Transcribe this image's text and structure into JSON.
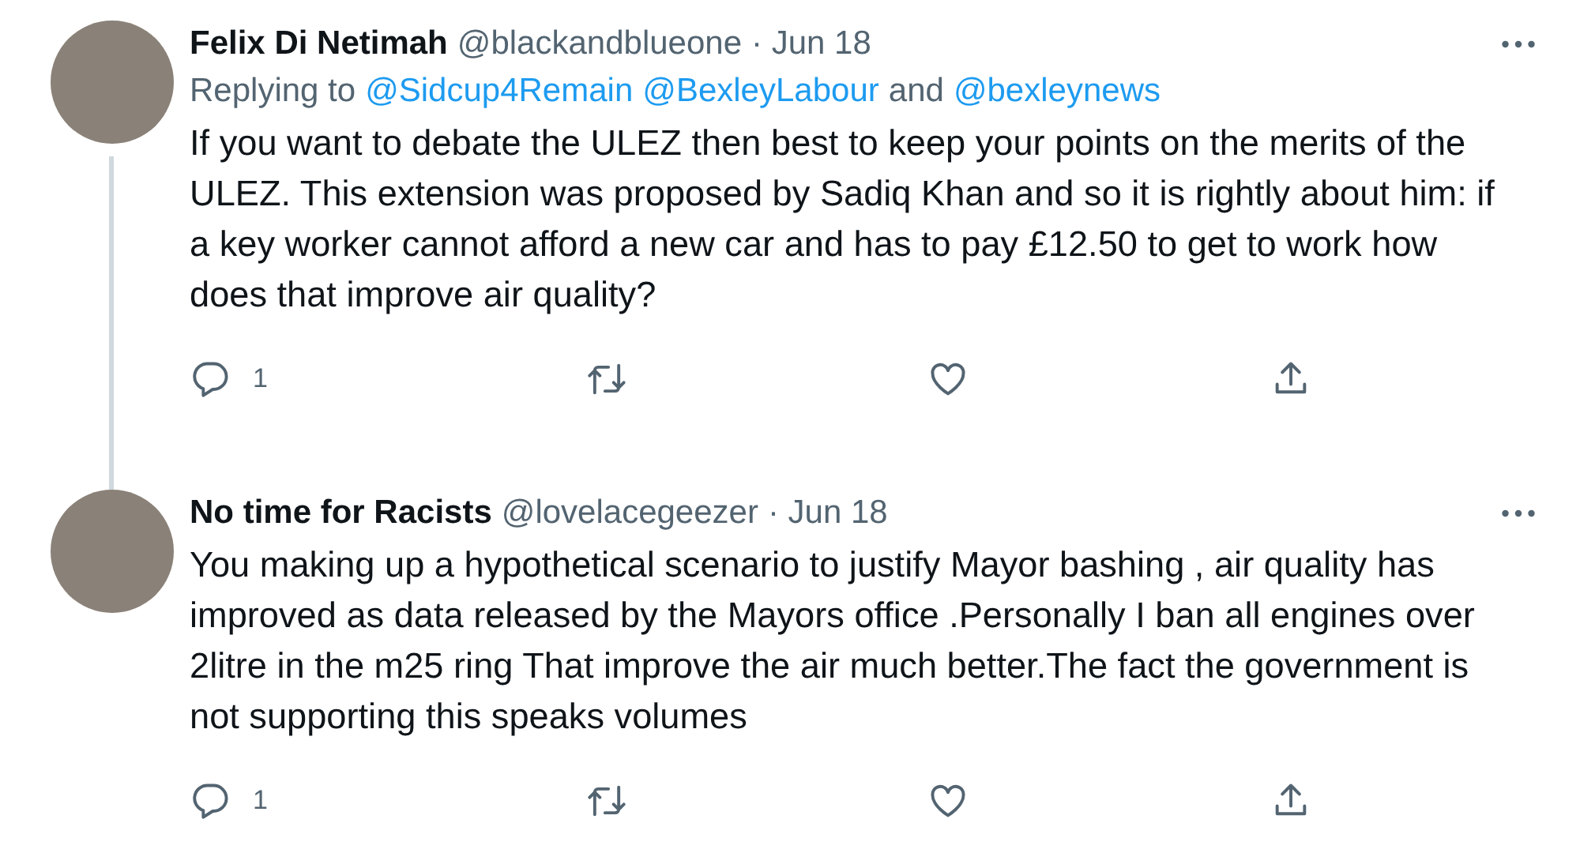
{
  "tweets": [
    {
      "name": "Felix Di Netimah",
      "handle": "@blackandblueone",
      "date": "· Jun 18",
      "thread_line": true,
      "replying": {
        "label": "Replying to",
        "mentions": [
          "@Sidcup4Remain",
          "@BexleyLabour"
        ],
        "conjunction": "and",
        "last": "@bexleynews"
      },
      "text": "If you want to debate the ULEZ then best to keep your points on the merits of the ULEZ. This extension was proposed by Sadiq Khan and so it is rightly about him: if a key worker cannot afford a new car and has to pay £12.50 to get to work how does that improve air quality?",
      "reply_count": "1"
    },
    {
      "name": "No time for Racists",
      "handle": "@lovelacegeezer",
      "date": "· Jun 18",
      "thread_line": false,
      "text": "You making up a hypothetical scenario to justify Mayor bashing , air quality has improved as data released by the Mayors office .Personally I ban all engines over 2litre in the m25 ring That improve the air much better.The fact the government is not supporting this speaks volumes",
      "reply_count": "1"
    }
  ]
}
